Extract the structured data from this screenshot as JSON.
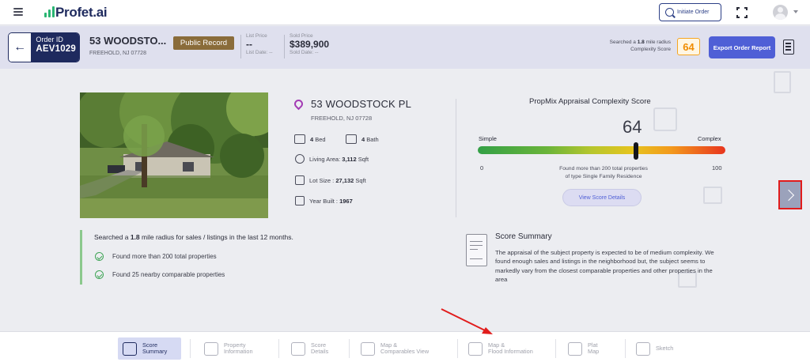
{
  "topbar": {
    "brand": "Profet",
    "brand_suffix": ".ai",
    "initiate_label": "Initiate Order"
  },
  "order": {
    "id_label": "Order ID",
    "id_value": "AEV1029",
    "address_short": "53 WOODSTO...",
    "city_state": "FREEHOLD, NJ 07728",
    "record_badge": "Public Record",
    "list_price_label": "List Price",
    "list_price_value": "--",
    "list_date": "List Date: --",
    "sold_price_label": "Sold Price",
    "sold_price_value": "$389,900",
    "sold_date": "Sold Date: --",
    "radius_text_pre": "Searched a ",
    "radius_value": "1.8",
    "radius_text_post": " mile radius",
    "complexity_label": "Complexity Score",
    "complexity_score": "64",
    "export_label": "Export Order Report"
  },
  "property": {
    "address": "53 WOODSTOCK PL",
    "city_state": "FREEHOLD, NJ 07728",
    "beds_value": "4",
    "beds_label": " Bed",
    "baths_value": "4",
    "baths_label": " Bath",
    "living_area_label": "Living Area: ",
    "living_area_value": "3,112",
    "living_area_unit": " Sqft",
    "lot_size_label": "Lot Size : ",
    "lot_size_value": "27,132",
    "lot_size_unit": " Sqft",
    "year_built_label": "Year Built : ",
    "year_built_value": "1967"
  },
  "score": {
    "title": "PropMix Appraisal Complexity Score",
    "value": "64",
    "value_fraction": 0.64,
    "simple_label": "Simple",
    "complex_label": "Complex",
    "min_label": "0",
    "max_label": "100",
    "found_line1": "Found more than 200 total properties",
    "found_line2": "of type Single Family Residence",
    "view_button": "View Score Details"
  },
  "search_summary": {
    "title_pre": "Searched a ",
    "radius": "1.8",
    "title_post": " mile radius for sales / listings in the last 12 months.",
    "items": [
      "Found more than 200 total properties",
      "Found 25 nearby comparable properties"
    ]
  },
  "score_summary": {
    "title": "Score Summary",
    "text": "The appraisal of the subject property is expected to be of medium complexity. We found enough sales and listings in the neighborhood but, the subject seems to markedly vary from the closest comparable properties and other properties in the area"
  },
  "bottom_nav": [
    {
      "line1": "Score",
      "line2": "Summary",
      "active": true
    },
    {
      "line1": "Property",
      "line2": "Information",
      "active": false
    },
    {
      "line1": "Score",
      "line2": "Details",
      "active": false
    },
    {
      "line1": "Map &",
      "line2": "Comparables View",
      "active": false
    },
    {
      "line1": "Map &",
      "line2": "Flood Information",
      "active": false
    },
    {
      "line1": "Plat",
      "line2": "Map",
      "active": false
    },
    {
      "line1": "Sketch",
      "line2": "",
      "active": false
    }
  ],
  "colors": {
    "brand_navy": "#1e2a5e",
    "accent_blue": "#4f5fd6",
    "score_orange": "#f08c00",
    "badge_brown": "#8a6c3a",
    "highlight_red": "#e11c1c"
  }
}
